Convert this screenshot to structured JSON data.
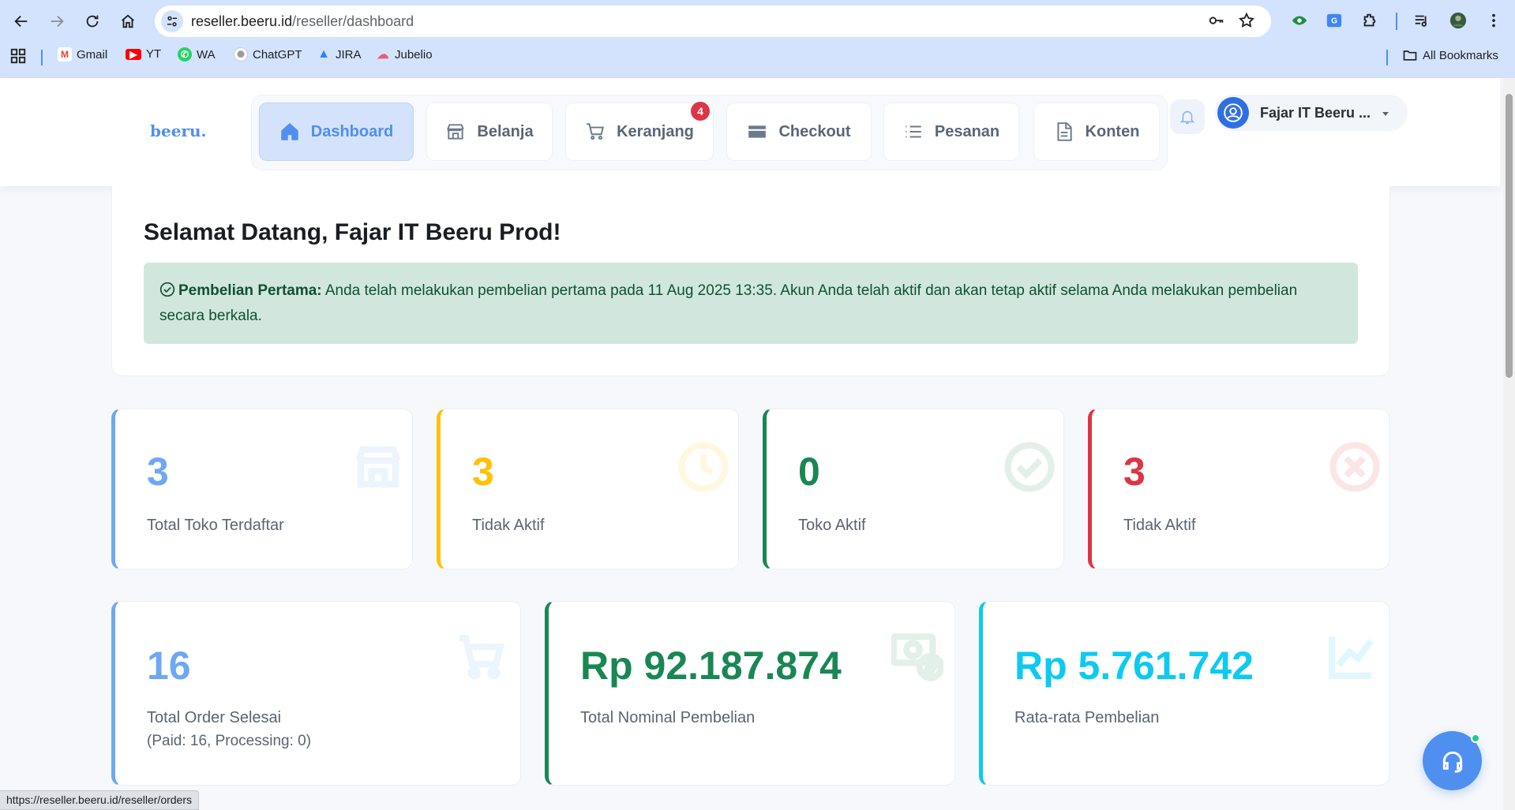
{
  "browser": {
    "url_host": "reseller.beeru.id",
    "url_path": "/reseller/dashboard",
    "bookmarks": [
      {
        "label": "Gmail",
        "icon": "gmail-icon"
      },
      {
        "label": "YT",
        "icon": "youtube-icon"
      },
      {
        "label": "WA",
        "icon": "whatsapp-icon"
      },
      {
        "label": "ChatGPT",
        "icon": "chatgpt-icon"
      },
      {
        "label": "JIRA",
        "icon": "jira-icon"
      },
      {
        "label": "Jubelio",
        "icon": "jubelio-icon"
      }
    ],
    "all_bookmarks": "All Bookmarks",
    "status_url": "https://reseller.beeru.id/reseller/orders"
  },
  "header": {
    "logo": "beeru.",
    "nav": [
      {
        "label": "Dashboard",
        "icon": "home-icon",
        "active": true
      },
      {
        "label": "Belanja",
        "icon": "store-icon"
      },
      {
        "label": "Keranjang",
        "icon": "cart-icon",
        "badge": "4"
      },
      {
        "label": "Checkout",
        "icon": "card-icon"
      },
      {
        "label": "Pesanan",
        "icon": "list-icon"
      },
      {
        "label": "Konten",
        "icon": "document-icon"
      }
    ],
    "user_name": "Fajar IT Beeru ..."
  },
  "welcome": {
    "title": "Selamat Datang, Fajar IT Beeru Prod!",
    "alert_label": "Pembelian Pertama:",
    "alert_text": "Anda telah melakukan pembelian pertama pada 11 Aug 2025 13:35. Akun Anda telah aktif dan akan tetap aktif selama Anda melakukan pembelian secara berkala."
  },
  "stats_row1": [
    {
      "value": "3",
      "label": "Total Toko Terdaftar",
      "color": "#6ea8f3",
      "icon": "store-icon"
    },
    {
      "value": "3",
      "label": "Tidak Aktif",
      "color": "#ffc107",
      "icon": "clock-icon"
    },
    {
      "value": "0",
      "label": "Toko Aktif",
      "color": "#198754",
      "icon": "check-circle-icon"
    },
    {
      "value": "3",
      "label": "Tidak Aktif",
      "color": "#dc3545",
      "icon": "x-circle-icon"
    }
  ],
  "stats_row2": [
    {
      "value": "16",
      "label": "Total Order Selesai",
      "sub": "(Paid: 16, Processing: 0)",
      "color": "#6ea8f3",
      "icon": "cart-icon"
    },
    {
      "value": "Rp 92.187.874",
      "label": "Total Nominal Pembelian",
      "color": "#198754",
      "icon": "money-icon"
    },
    {
      "value": "Rp 5.761.742",
      "label": "Rata-rata Pembelian",
      "color": "#0dcaf0",
      "icon": "chart-line-icon"
    }
  ]
}
